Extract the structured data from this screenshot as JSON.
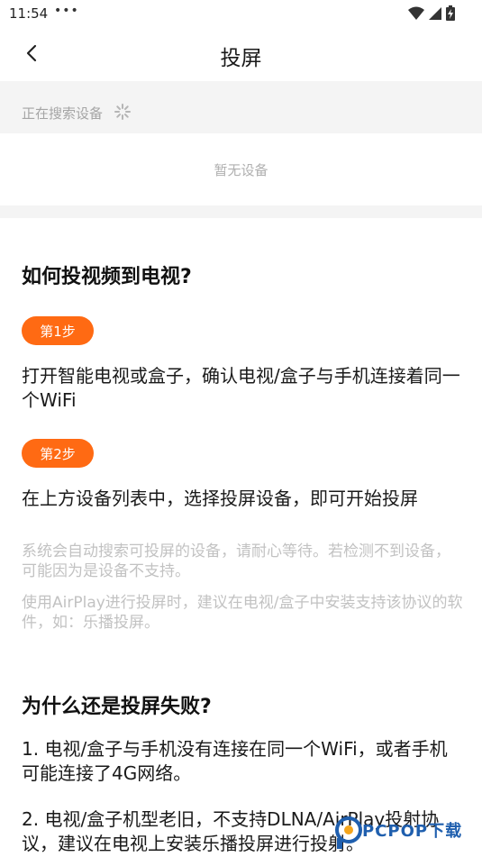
{
  "status_bar": {
    "time": "11:54",
    "dots": "•••",
    "icons": [
      "wifi-icon",
      "signal-icon",
      "battery-charging-icon"
    ]
  },
  "nav": {
    "back_icon": "chevron-left-icon",
    "title": "投屏"
  },
  "search": {
    "status": "正在搜索设备",
    "spinner_icon": "spinner-icon",
    "empty": "暂无设备"
  },
  "help": {
    "section1_title": "如何投视频到电视?",
    "steps": [
      {
        "badge": "第1步",
        "text": "打开智能电视或盒子，确认电视/盒子与手机连接着同一个WiFi"
      },
      {
        "badge": "第2步",
        "text": "在上方设备列表中，选择投屏设备，即可开始投屏"
      }
    ],
    "notes": [
      "系统会自动搜索可投屏的设备，请耐心等待。若检测不到设备，可能因为是设备不支持。",
      "使用AirPlay进行投屏时，建议在电视/盒子中安装支持该协议的软件，如：乐播投屏。"
    ],
    "section2_title": "为什么还是投屏失败?",
    "reasons": [
      "1. 电视/盒子与手机没有连接在同一个WiFi，或者手机可能连接了4G网络。",
      "2. 电视/盒子机型老旧，不支持DLNA/AirPlay投射协议，建议在电视上安装乐播投屏进行投射。"
    ]
  },
  "watermark": {
    "text": "PCPOP下载"
  },
  "colors": {
    "accent": "#ff6a13",
    "band": "#f4f4f4",
    "muted": "#c2c2c2"
  }
}
